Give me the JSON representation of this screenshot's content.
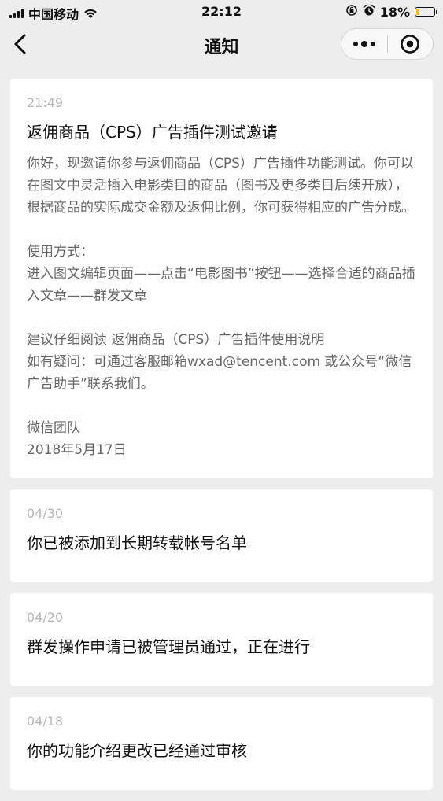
{
  "status_bar": {
    "carrier": "中国移动",
    "time": "22:12",
    "battery_percent": "18%",
    "battery_level": 0.18,
    "battery_color": "#f3c10e"
  },
  "nav": {
    "title": "通知"
  },
  "notifications": [
    {
      "date": "21:49",
      "title": "返佣商品（CPS）广告插件测试邀请",
      "paragraphs": [
        "你好，现邀请你参与返佣商品（CPS）广告插件功能测试。你可以在图文中灵活插入电影类目的商品（图书及更多类目后续开放），根据商品的实际成交金额及返佣比例，你可获得相应的广告分成。",
        "使用方式：\n进入图文编辑页面——点击“电影图书”按钮——选择合适的商品插入文章——群发文章",
        "建议仔细阅读 返佣商品（CPS）广告插件使用说明\n如有疑问：可通过客服邮箱wxad@tencent.com 或公众号“微信广告助手”联系我们。",
        "微信团队\n2018年5月17日"
      ]
    },
    {
      "date": "04/30",
      "title": "你已被添加到长期转载帐号名单"
    },
    {
      "date": "04/20",
      "title": "群发操作申请已被管理员通过，正在进行"
    },
    {
      "date": "04/18",
      "title": "你的功能介绍更改已经通过审核"
    }
  ]
}
